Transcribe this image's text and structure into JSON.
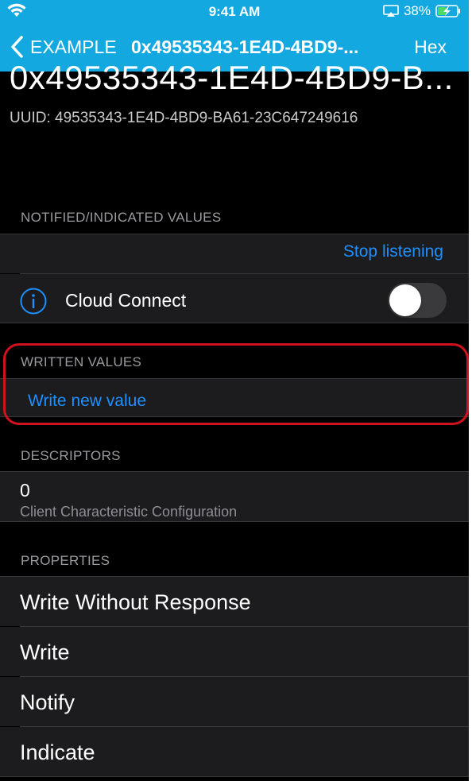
{
  "status_bar": {
    "time": "9:41 AM",
    "battery": "38%"
  },
  "nav": {
    "back_label": "EXAMPLE",
    "title": "0x49535343-1E4D-4BD9-...",
    "right_button": "Hex"
  },
  "header": {
    "big_title": "0x49535343-1E4D-4BD9-B...",
    "uuid": "UUID: 49535343-1E4D-4BD9-BA61-23C647249616"
  },
  "notified": {
    "header": "NOTIFIED/INDICATED VALUES",
    "stop_listening": "Stop listening",
    "cloud_connect": "Cloud Connect",
    "toggle_on": false
  },
  "written": {
    "header": "WRITTEN VALUES",
    "write_new_value": "Write new value"
  },
  "descriptors": {
    "header": "DESCRIPTORS",
    "items": [
      {
        "value": "0",
        "name": "Client Characteristic Configuration"
      }
    ]
  },
  "properties": {
    "header": "PROPERTIES",
    "items": [
      {
        "label": "Write Without Response"
      },
      {
        "label": "Write"
      },
      {
        "label": "Notify"
      },
      {
        "label": "Indicate"
      }
    ]
  },
  "colors": {
    "nav_background": "#13a8e0",
    "link": "#1e90ff",
    "highlight_border": "#d0111e",
    "cell_background": "#1c1c1e"
  },
  "icons": [
    "wifi-icon",
    "airplay-icon",
    "battery-charging-icon",
    "back-chevron-icon",
    "info-icon"
  ]
}
